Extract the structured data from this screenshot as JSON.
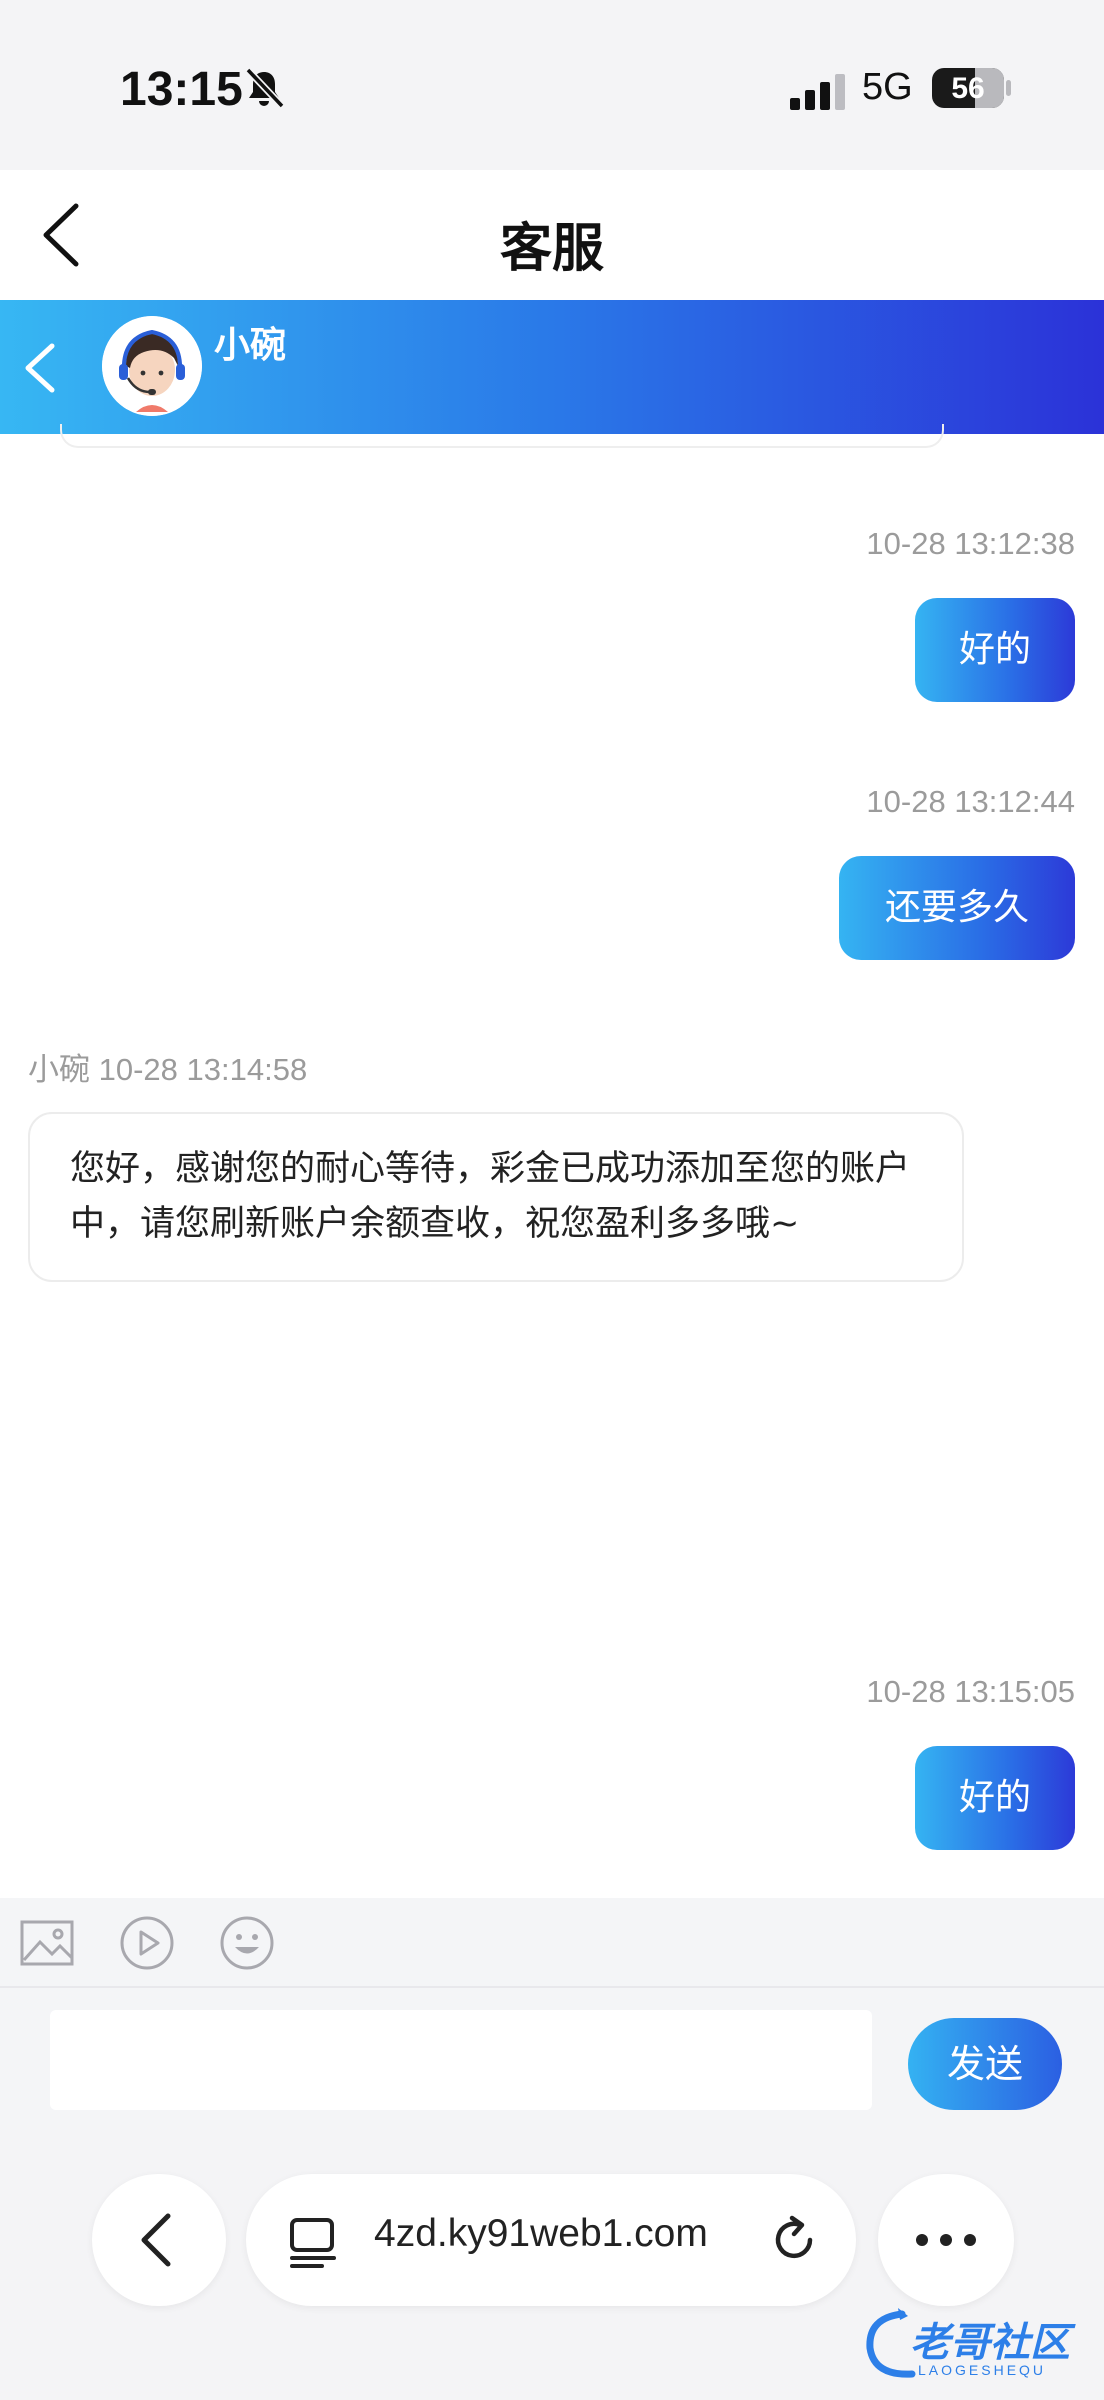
{
  "status_bar": {
    "time": "13:15",
    "network": "5G",
    "battery": "56"
  },
  "header": {
    "title": "客服"
  },
  "agent": {
    "name": "小碗"
  },
  "messages": [
    {
      "direction": "out",
      "timestamp": "10-28 13:12:38",
      "text": "好的"
    },
    {
      "direction": "out",
      "timestamp": "10-28 13:12:44",
      "text": "还要多久"
    },
    {
      "direction": "in",
      "sender": "小碗",
      "timestamp": "10-28 13:14:58",
      "text": "您好，感谢您的耐心等待，彩金已成功添加至您的账户中，请您刷新账户余额查收，祝您盈利多多哦~"
    },
    {
      "direction": "out",
      "timestamp": "10-28 13:15:05",
      "text": "好的"
    }
  ],
  "composer": {
    "value": "",
    "send_label": "发送",
    "tools": [
      "image-icon",
      "video-icon",
      "emoji-icon"
    ]
  },
  "browser": {
    "url": "4zd.ky91web1.com"
  },
  "watermark": {
    "text": "老哥社区",
    "sub": "LAOGESHEQU"
  },
  "colors": {
    "accent_start": "#37b7f3",
    "accent_end": "#2b32d8"
  }
}
